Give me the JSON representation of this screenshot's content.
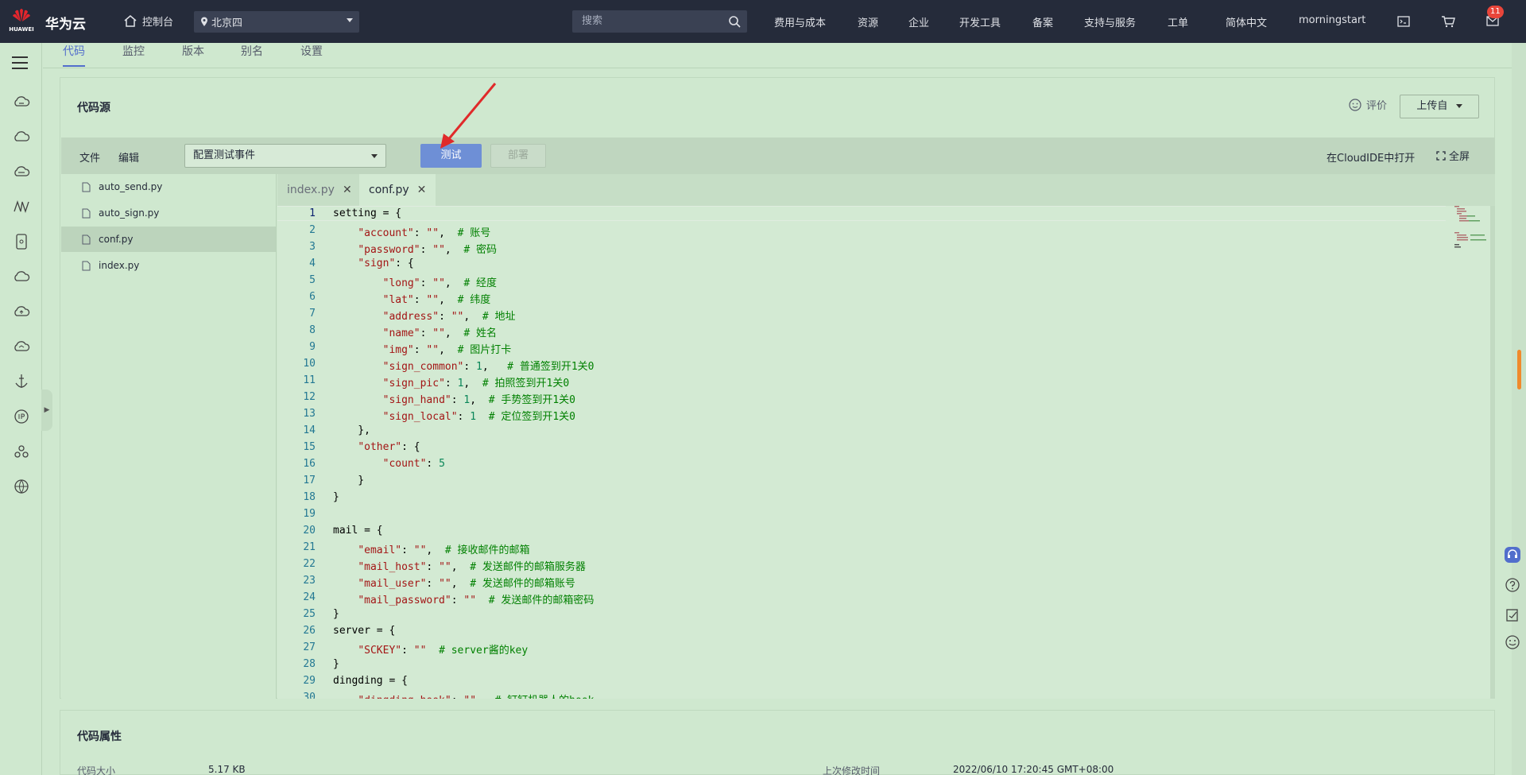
{
  "header": {
    "logo_text": "HUAWEI",
    "brand": "华为云",
    "console": "控制台",
    "region": "北京四",
    "search_placeholder": "搜索",
    "nav": [
      "费用与成本",
      "资源",
      "企业",
      "开发工具",
      "备案",
      "支持与服务",
      "工单",
      "简体中文",
      "morningstart"
    ],
    "badge_count": "11"
  },
  "sidebar": {
    "icons": [
      "menu-icon",
      "cloud-server-icon",
      "cloud-icon",
      "database-icon",
      "function-icon",
      "storage-icon",
      "cloud-container-icon",
      "cloud-upload-icon",
      "cloud-network-icon",
      "anchor-icon",
      "ip-icon",
      "cluster-icon",
      "globe-icon"
    ]
  },
  "tabs": [
    "代码",
    "监控",
    "版本",
    "别名",
    "设置"
  ],
  "code_source": {
    "title": "代码源",
    "rate_label": "评价",
    "upload_label": "上传自",
    "toolbar": {
      "file": "文件",
      "edit": "编辑",
      "event_select": "配置测试事件",
      "test": "测试",
      "deploy": "部署",
      "cloudide": "在CloudIDE中打开",
      "fullscreen": "全屏"
    },
    "files": [
      "auto_send.py",
      "auto_sign.py",
      "conf.py",
      "index.py"
    ],
    "selected_file": "conf.py",
    "editor_tabs": [
      "index.py",
      "conf.py"
    ],
    "active_tab": "conf.py",
    "code_lines": [
      "setting = {",
      "    \"account\": \"\",  # 账号",
      "    \"password\": \"\",  # 密码",
      "    \"sign\": {",
      "        \"long\": \"\",  # 经度",
      "        \"lat\": \"\",  # 纬度",
      "        \"address\": \"\",  # 地址",
      "        \"name\": \"\",  # 姓名",
      "        \"img\": \"\",  # 图片打卡",
      "        \"sign_common\": 1,   # 普通签到开1关0",
      "        \"sign_pic\": 1,  # 拍照签到开1关0",
      "        \"sign_hand\": 1,  # 手势签到开1关0",
      "        \"sign_local\": 1  # 定位签到开1关0",
      "    },",
      "    \"other\": {",
      "        \"count\": 5",
      "    }",
      "}",
      "",
      "mail = {",
      "    \"email\": \"\",  # 接收邮件的邮箱",
      "    \"mail_host\": \"\",  # 发送邮件的邮箱服务器",
      "    \"mail_user\": \"\",  # 发送邮件的邮箱账号",
      "    \"mail_password\": \"\"  # 发送邮件的邮箱密码",
      "}",
      "server = {",
      "    \"SCKEY\": \"\"  # server酱的key",
      "}",
      "dingding = {",
      "    \"dingding_hook\": \"\",  # 钉钉机器人的hook"
    ]
  },
  "code_props": {
    "title": "代码属性",
    "size_label": "代码大小",
    "size_value": "5.17 KB",
    "modified_label": "上次修改时间",
    "modified_value": "2022/06/10 17:20:45 GMT+08:00"
  },
  "colors": {
    "accent": "#526ecc",
    "test_button": "#6e8fd6",
    "background": "#cfe8cf",
    "topbar": "#252b3a",
    "arrow": "#e02a2a"
  }
}
